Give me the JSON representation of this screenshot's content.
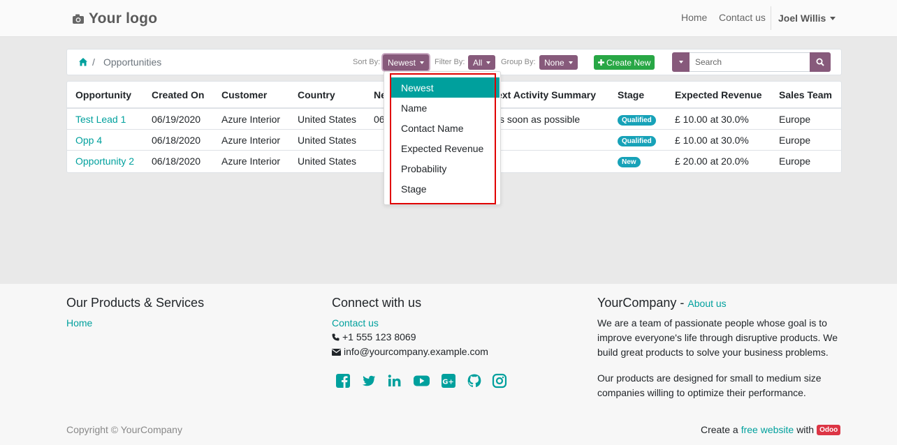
{
  "header": {
    "logo_text": "Your logo",
    "nav": {
      "home": "Home",
      "contact": "Contact us",
      "user": "Joel Willis"
    }
  },
  "breadcrumb": {
    "separator": "/",
    "current": "Opportunities"
  },
  "toolbar": {
    "sort_label": "Sort By:",
    "sort_value": "Newest",
    "filter_label": "Filter By:",
    "filter_value": "All",
    "group_label": "Group By:",
    "group_value": "None",
    "create_label": "Create New",
    "search_placeholder": "Search"
  },
  "table": {
    "columns": [
      "Opportunity",
      "Created On",
      "Customer",
      "Country",
      "Ne",
      "Next Activity Summary",
      "Stage",
      "Expected Revenue",
      "Sales Team"
    ],
    "rows": [
      {
        "name": "Test Lead 1",
        "created": "06/19/2020",
        "customer": "Azure Interior",
        "country": "United States",
        "next_partial": "06",
        "activity_partial": "s soon as possible",
        "stage": "Qualified",
        "revenue": "£ 10.00 at 30.0%",
        "team": "Europe"
      },
      {
        "name": "Opp 4",
        "created": "06/18/2020",
        "customer": "Azure Interior",
        "country": "United States",
        "next_partial": "",
        "activity_partial": "",
        "stage": "Qualified",
        "revenue": "£ 10.00 at 30.0%",
        "team": "Europe"
      },
      {
        "name": "Opportunity 2",
        "created": "06/18/2020",
        "customer": "Azure Interior",
        "country": "United States",
        "next_partial": "",
        "activity_partial": "",
        "stage": "New",
        "revenue": "£ 20.00 at 20.0%",
        "team": "Europe"
      }
    ]
  },
  "sort_menu": {
    "items": [
      "Newest",
      "Name",
      "Contact Name",
      "Expected Revenue",
      "Probability",
      "Stage"
    ],
    "active": "Newest"
  },
  "footer": {
    "products_heading": "Our Products & Services",
    "products_home": "Home",
    "connect_heading": "Connect with us",
    "connect_contact": "Contact us",
    "phone": "+1 555 123 8069",
    "email": "info@yourcompany.example.com",
    "company_heading": "YourCompany",
    "company_dash": "-",
    "about_link": "About us",
    "about_p1": "We are a team of passionate people whose goal is to improve everyone's life through disruptive products. We build great products to solve your business problems.",
    "about_p2": "Our products are designed for small to medium size companies willing to optimize their performance.",
    "social_icons": [
      "facebook-icon",
      "twitter-icon",
      "linkedin-icon",
      "youtube-icon",
      "google-plus-icon",
      "github-icon",
      "instagram-icon"
    ],
    "copyright": "Copyright © YourCompany",
    "credit_prefix": "Create a",
    "credit_link": "free website",
    "credit_with": "with",
    "credit_badge": "Odoo"
  },
  "colors": {
    "accent": "#00A09D",
    "primary": "#875a7b",
    "success": "#28a745",
    "info": "#17a2b8",
    "danger": "#dc3545",
    "highlight_border": "#e00000"
  }
}
